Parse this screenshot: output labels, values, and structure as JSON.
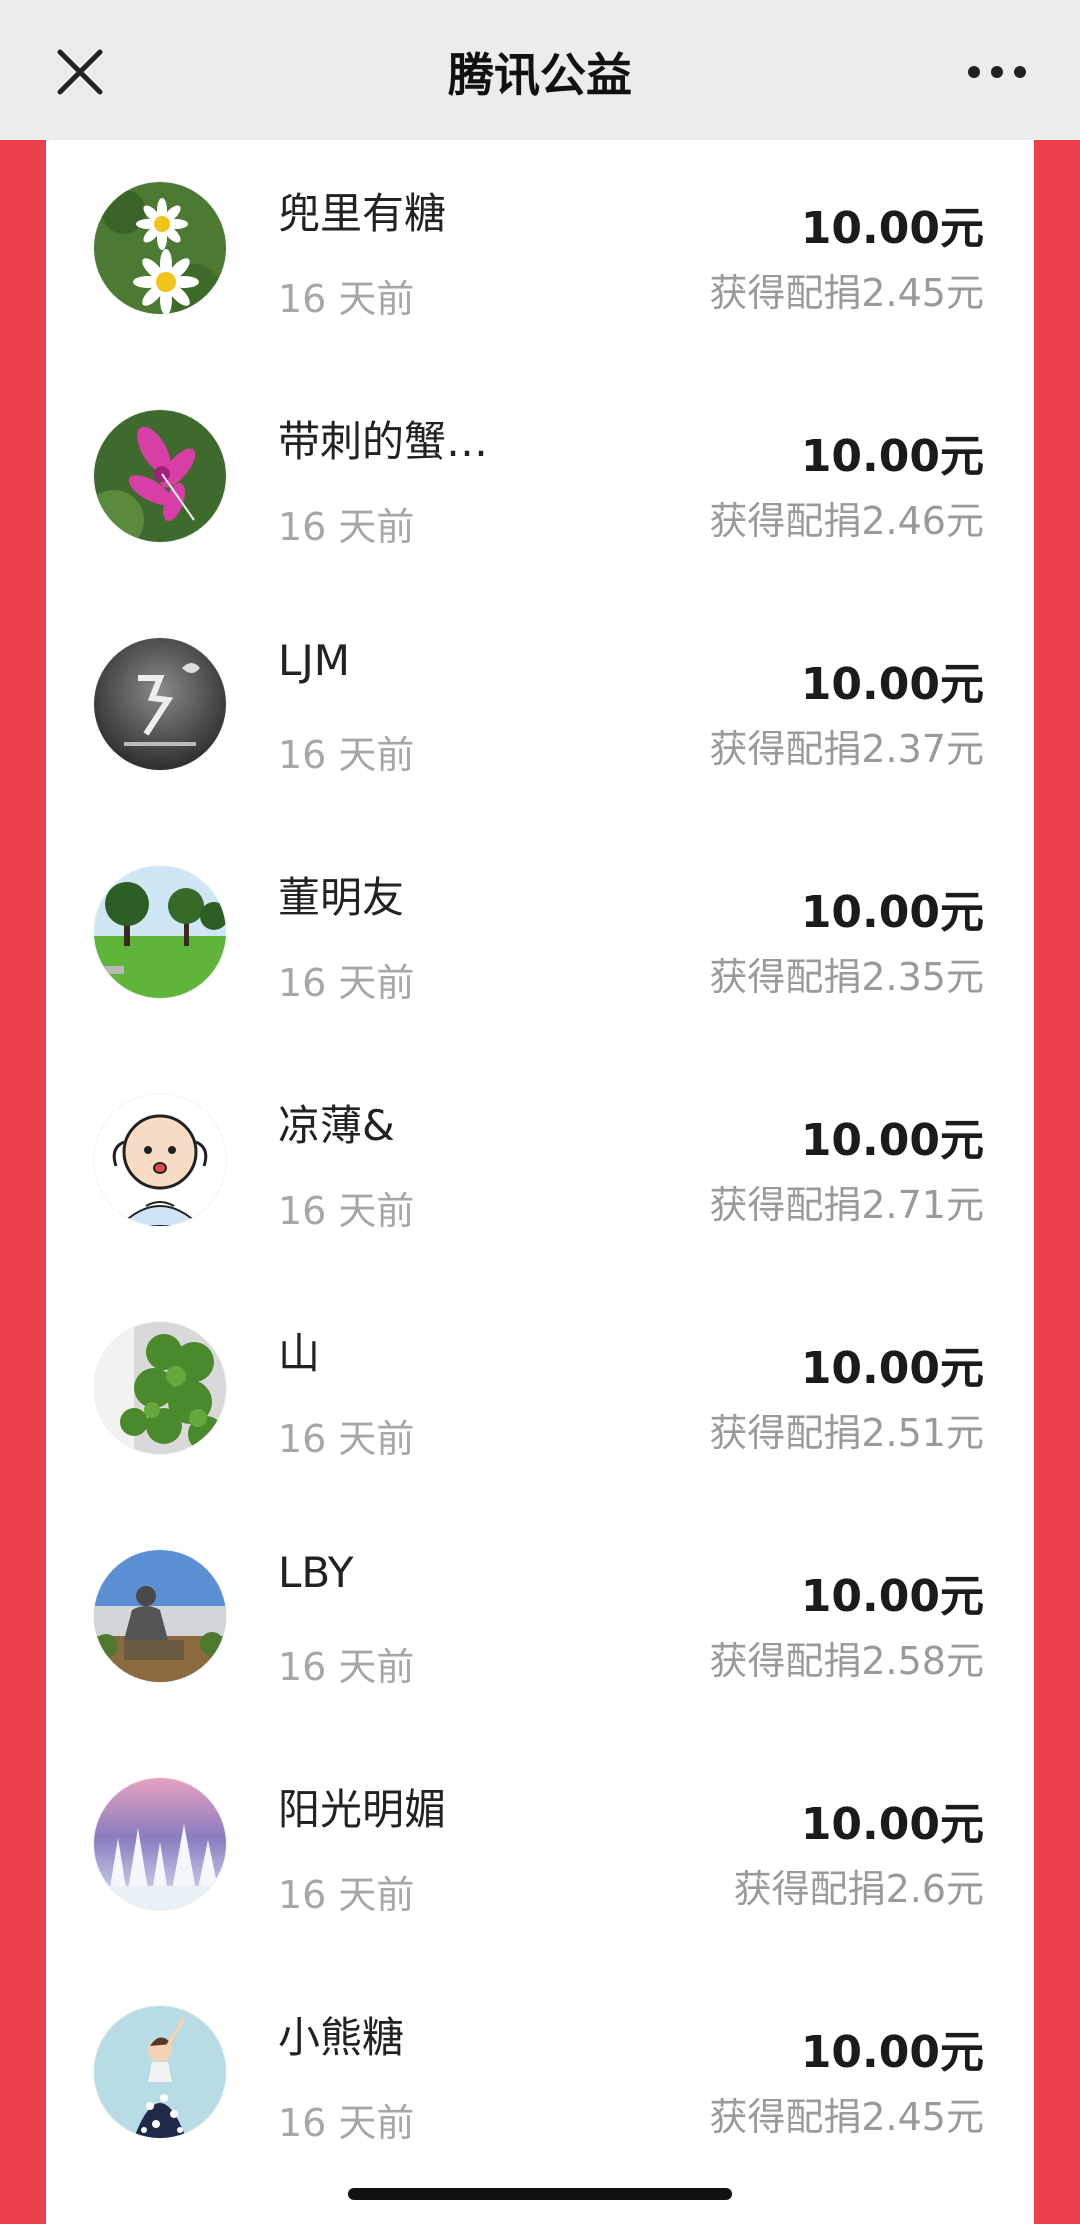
{
  "header": {
    "title": "腾讯公益",
    "close_icon": "close-icon",
    "more_icon": "more-icon"
  },
  "colors": {
    "side_red": "#e9404b",
    "top_gray": "#ececec"
  },
  "donations": [
    {
      "name": "兜里有糖",
      "time": "16 天前",
      "amount": "10.00元",
      "match": "获得配捐2.45元",
      "avatar": "daisy"
    },
    {
      "name": "带刺的蟹…",
      "time": "16 天前",
      "amount": "10.00元",
      "match": "获得配捐2.46元",
      "avatar": "pink-flower"
    },
    {
      "name": "LJM",
      "time": "16 天前",
      "amount": "10.00元",
      "match": "获得配捐2.37元",
      "avatar": "dark-logo"
    },
    {
      "name": "董明友",
      "time": "16 天前",
      "amount": "10.00元",
      "match": "获得配捐2.35元",
      "avatar": "trees"
    },
    {
      "name": "凉薄&",
      "time": "16 天前",
      "amount": "10.00元",
      "match": "获得配捐2.71元",
      "avatar": "cartoon"
    },
    {
      "name": "山",
      "time": "16 天前",
      "amount": "10.00元",
      "match": "获得配捐2.51元",
      "avatar": "ivy"
    },
    {
      "name": "LBY",
      "time": "16 天前",
      "amount": "10.00元",
      "match": "获得配捐2.58元",
      "avatar": "statue"
    },
    {
      "name": "阳光明媚",
      "time": "16 天前",
      "amount": "10.00元",
      "match": "获得配捐2.6元",
      "avatar": "snow"
    },
    {
      "name": "小熊糖",
      "time": "16 天前",
      "amount": "10.00元",
      "match": "获得配捐2.45元",
      "avatar": "dancer"
    }
  ]
}
